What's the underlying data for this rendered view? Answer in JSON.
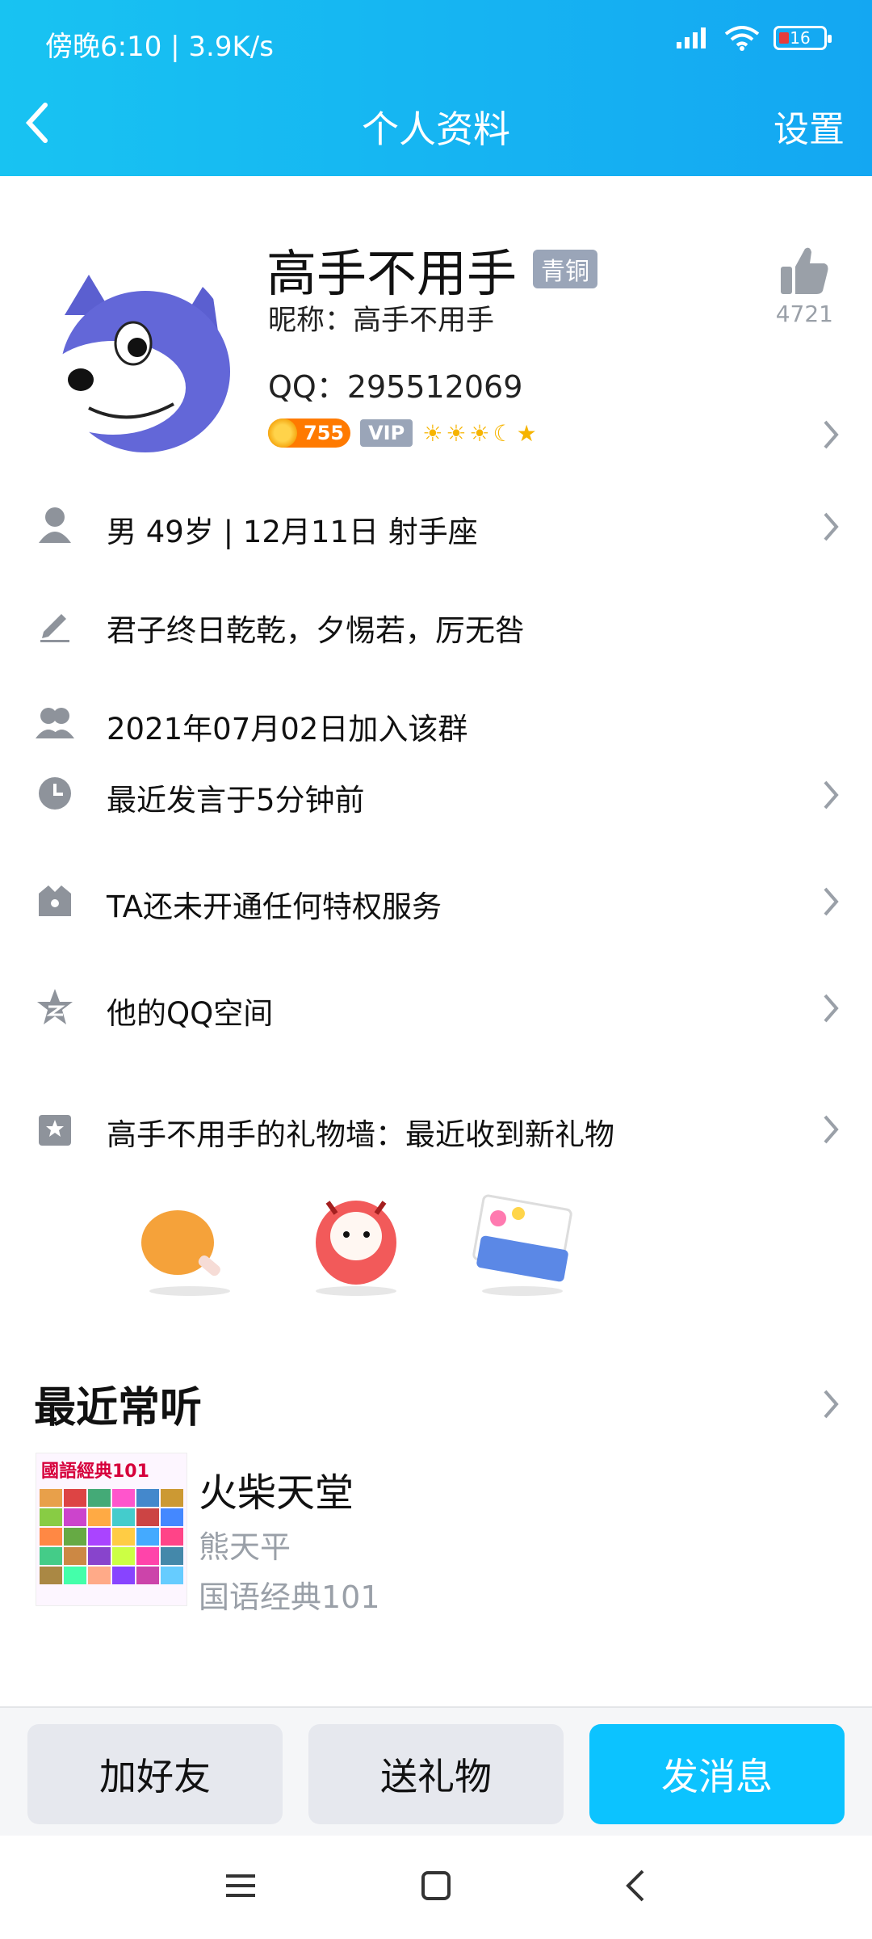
{
  "status_bar": {
    "time": "傍晚6:10 | 3.9K/s",
    "battery": "16"
  },
  "header": {
    "title": "个人资料",
    "settings": "设置"
  },
  "profile": {
    "name": "高手不用手",
    "badge": "青铜",
    "nickname": "昵称：高手不用手",
    "qq": "QQ：295512069",
    "coins": "755",
    "vip": "VIP",
    "likes": "4721"
  },
  "rows": {
    "info": "男  49岁  |  12月11日  射手座",
    "signature": "君子终日乾乾，夕惕若，厉无咎",
    "joined": "2021年07月02日加入该群",
    "last_speak": "最近发言于5分钟前",
    "privilege": "TA还未开通任何特权服务",
    "qzone": "他的QQ空间",
    "gift_wall": "高手不用手的礼物墙：最近收到新礼物"
  },
  "music": {
    "section_title": "最近常听",
    "song": "火柴天堂",
    "artist": "熊天平",
    "album": "国语经典101",
    "album_cover_text": "國語經典101"
  },
  "actions": {
    "add_friend": "加好友",
    "send_gift": "送礼物",
    "send_message": "发消息"
  },
  "colors": {
    "header_start": "#18c3f2",
    "header_end": "#14a7f2",
    "accent": "#0cc3ff"
  }
}
